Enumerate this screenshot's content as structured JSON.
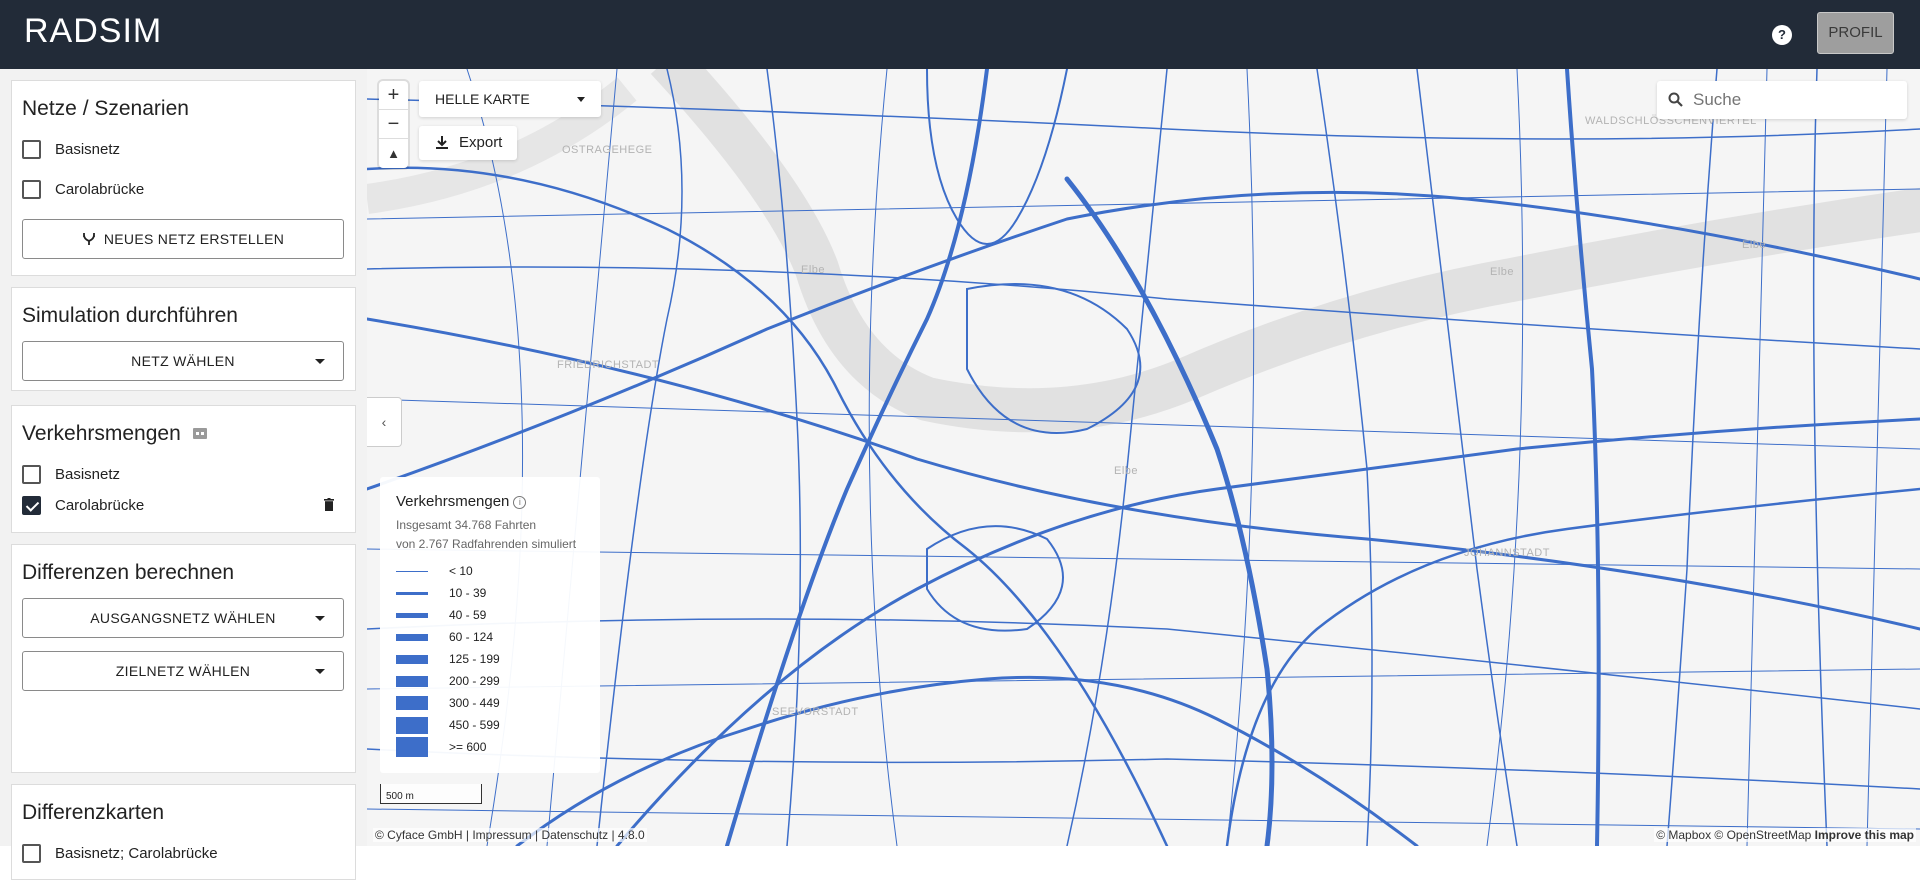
{
  "app": {
    "logo": "RADSIM"
  },
  "header": {
    "help_icon": "?",
    "profile_label": "PROFIL"
  },
  "sidebar": {
    "netze": {
      "title": "Netze / Szenarien",
      "items": [
        {
          "label": "Basisnetz",
          "checked": false
        },
        {
          "label": "Carolabrücke",
          "checked": false
        }
      ],
      "new_net_button": "NEUES NETZ ERSTELLEN"
    },
    "simulation": {
      "title": "Simulation durchführen",
      "select_label": "NETZ WÄHLEN"
    },
    "verkehr": {
      "title": "Verkehrsmengen",
      "items": [
        {
          "label": "Basisnetz",
          "checked": false
        },
        {
          "label": "Carolabrücke",
          "checked": true
        }
      ]
    },
    "differenzen": {
      "title": "Differenzen berechnen",
      "source_label": "AUSGANGSNETZ WÄHLEN",
      "target_label": "ZIELNETZ WÄHLEN"
    },
    "differenzkarten": {
      "title": "Differenzkarten",
      "items": [
        {
          "label": "Basisnetz; Carolabrücke",
          "checked": false
        }
      ]
    }
  },
  "map": {
    "zoom_in": "+",
    "zoom_out": "−",
    "compass": "▲",
    "basemap_label": "HELLE KARTE",
    "export_label": "Export",
    "search_placeholder": "Suche",
    "collapse_icon": "‹",
    "scale_label": "500 m",
    "attribution_left": "© Cyface GmbH | Impressum | Datenschutz | 4.8.0",
    "attribution_right_a": "© Mapbox © OpenStreetMap",
    "attribution_right_b": "Improve this map",
    "place_labels": [
      "OSTRAGEHEGE",
      "FRIEDRICHSTADT",
      "SEEVORSTADT",
      "JOHANNSTADT",
      "WALDSCHLÖSSCHENVIERTEL",
      "Elbe",
      "Elbe",
      "Elbe",
      "Elbe"
    ],
    "road_color": "#3d6ec9",
    "legend": {
      "title": "Verkehrsmengen",
      "info_icon": "i",
      "line1": "Insgesamt 34.768 Fahrten",
      "line2": "von 2.767 Radfahrenden simuliert",
      "classes": [
        {
          "label": "< 10",
          "width": 1
        },
        {
          "label": "10 - 39",
          "width": 3
        },
        {
          "label": "40 - 59",
          "width": 5
        },
        {
          "label": "60 - 124",
          "width": 7
        },
        {
          "label": "125 - 199",
          "width": 9
        },
        {
          "label": "200 - 299",
          "width": 11
        },
        {
          "label": "300 - 449",
          "width": 14
        },
        {
          "label": "450 - 599",
          "width": 17
        },
        {
          "label": ">= 600",
          "width": 20
        }
      ]
    }
  }
}
